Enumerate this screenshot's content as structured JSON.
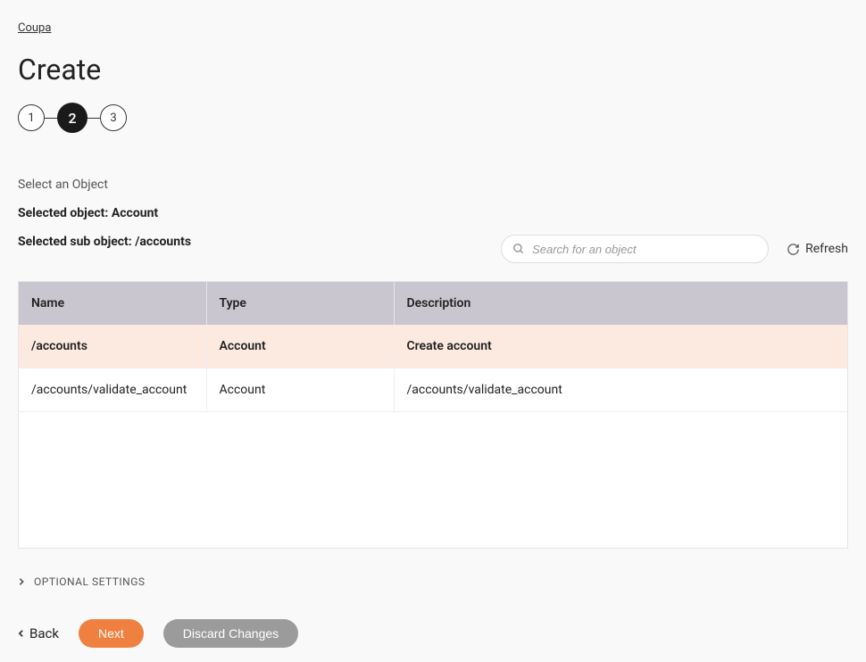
{
  "breadcrumb": "Coupa",
  "page_title": "Create",
  "stepper": {
    "s1": "1",
    "s2": "2",
    "s3": "3"
  },
  "section_label": "Select an Object",
  "selected_object_label": "Selected object: ",
  "selected_object_value": "Account",
  "selected_sub_label": "Selected sub object: ",
  "selected_sub_value": "/accounts",
  "search_placeholder": "Search for an object",
  "refresh_label": "Refresh",
  "table": {
    "headers": {
      "name": "Name",
      "type": "Type",
      "desc": "Description"
    },
    "rows": [
      {
        "name": "/accounts",
        "type": "Account",
        "desc": "Create account",
        "selected": true
      },
      {
        "name": "/accounts/validate_account",
        "type": "Account",
        "desc": "/accounts/validate_account",
        "selected": false
      }
    ]
  },
  "optional_label": "OPTIONAL SETTINGS",
  "footer": {
    "back": "Back",
    "next": "Next",
    "discard": "Discard Changes"
  }
}
